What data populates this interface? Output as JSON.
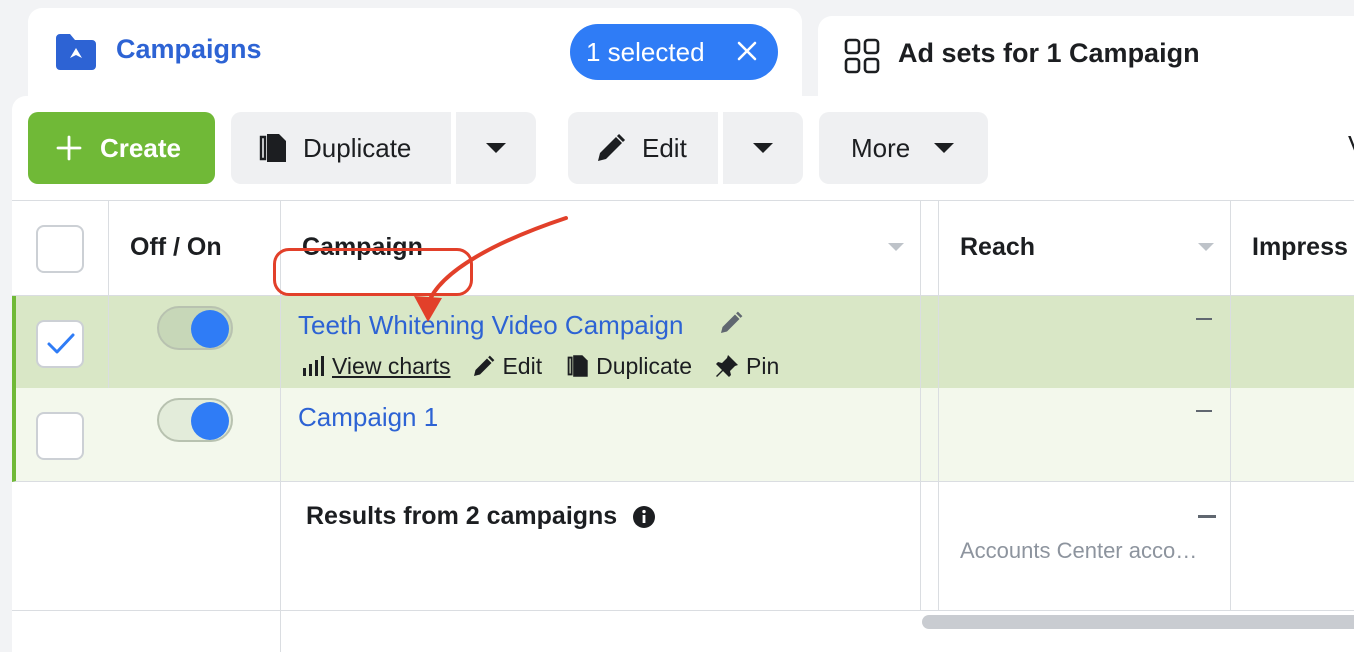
{
  "tabs": {
    "campaigns": {
      "label": "Campaigns",
      "selected_badge": "1 selected"
    },
    "adsets": {
      "label": "Ad sets for 1 Campaign"
    }
  },
  "toolbar": {
    "create_label": "Create",
    "duplicate_label": "Duplicate",
    "edit_label": "Edit",
    "more_label": "More",
    "cut_text": "V"
  },
  "table": {
    "headers": {
      "off_on": "Off / On",
      "campaign": "Campaign",
      "reach": "Reach",
      "impressions": "Impress"
    },
    "rows": [
      {
        "name": "Teeth Whitening Video Campaign",
        "selected": true,
        "toggle_on": true,
        "actions": {
          "view_charts": "View charts",
          "edit": "Edit",
          "duplicate": "Duplicate",
          "pin": "Pin"
        },
        "reach": "—"
      },
      {
        "name": "Campaign 1",
        "selected": false,
        "toggle_on": true,
        "reach": "—"
      }
    ],
    "summary": {
      "label": "Results from 2 campaigns",
      "reach": "—",
      "reach_note": "Accounts Center acco…"
    }
  },
  "colors": {
    "accent_blue": "#2f7cf6",
    "create_green": "#70b937",
    "annotation_red": "#e2402a"
  }
}
